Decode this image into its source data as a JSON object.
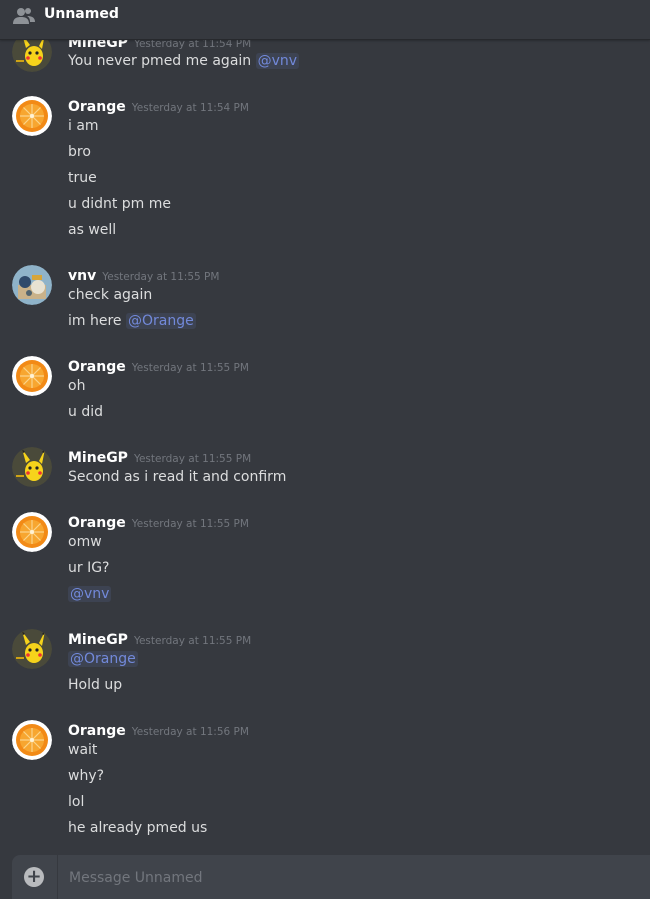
{
  "channel": {
    "title": "Unnamed"
  },
  "messages": [
    {
      "author": "MineGP",
      "avatar": "pikachu-avatar",
      "time": "Yesterday at 11:54 PM",
      "lines": [
        [
          "You never pmed me again ",
          "@vnv"
        ]
      ]
    },
    {
      "author": "Orange",
      "avatar": "orange-avatar",
      "time": "Yesterday at 11:54 PM",
      "lines": [
        "i am",
        "bro",
        "true",
        "u didnt pm me",
        "as well"
      ]
    },
    {
      "author": "vnv",
      "avatar": "vnv-avatar",
      "time": "Yesterday at 11:55 PM",
      "lines": [
        "check again",
        [
          "im here ",
          "@Orange"
        ]
      ]
    },
    {
      "author": "Orange",
      "avatar": "orange-avatar",
      "time": "Yesterday at 11:55 PM",
      "lines": [
        "oh",
        "u did"
      ]
    },
    {
      "author": "MineGP",
      "avatar": "pikachu-avatar",
      "time": "Yesterday at 11:55 PM",
      "lines": [
        "Second as i read it and confirm"
      ]
    },
    {
      "author": "Orange",
      "avatar": "orange-avatar",
      "time": "Yesterday at 11:55 PM",
      "lines": [
        "omw",
        "ur IG?",
        "@vnv"
      ]
    },
    {
      "author": "MineGP",
      "avatar": "pikachu-avatar",
      "time": "Yesterday at 11:55 PM",
      "lines": [
        "@Orange",
        "Hold up"
      ]
    },
    {
      "author": "Orange",
      "avatar": "orange-avatar",
      "time": "Yesterday at 11:56 PM",
      "lines": [
        "wait",
        "why?",
        "lol",
        "he already pmed us"
      ]
    }
  ],
  "composer": {
    "placeholder": "Message Unnamed",
    "plus_icon": "plus-circle-icon"
  },
  "colors": {
    "background": "#36393f",
    "mention": "#7289da",
    "input_bg": "#40444b"
  }
}
